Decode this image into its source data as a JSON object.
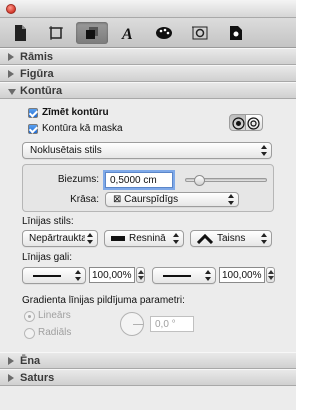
{
  "tabs": [
    {
      "icon": "document-icon",
      "active": false
    },
    {
      "icon": "ruler-icon",
      "active": false
    },
    {
      "icon": "graphic-icon",
      "active": true
    },
    {
      "icon": "text-icon",
      "active": false
    },
    {
      "icon": "color-palette-icon",
      "active": false
    },
    {
      "icon": "metrics-icon",
      "active": false
    },
    {
      "icon": "image-icon",
      "active": false
    }
  ],
  "sections": {
    "ramis": "Rāmis",
    "figura": "Figūra",
    "kontura": "Kontūra",
    "ena": "Ēna",
    "saturs": "Saturs"
  },
  "outline": {
    "draw_outline_label": "Zīmēt kontūru",
    "draw_outline_checked": true,
    "outline_as_mask_label": "Kontūra kā maska",
    "outline_as_mask_checked": true,
    "style_popup": "Noklusētais stils",
    "thickness_label": "Biezums:",
    "thickness_value": "0,5000 cm",
    "thickness_slider_fraction": 0.12,
    "color_label": "Krāsa:",
    "color_value": "⊠ Caurspīdīgs"
  },
  "line_style": {
    "label": "Līnijas stils:",
    "dash_popup": "Nepārtraukta",
    "cap_popup": "Resninā",
    "join_popup": "Taisns"
  },
  "line_ends": {
    "label": "Līnijas gali:",
    "start_scale": "100,00%",
    "end_scale": "100,00%"
  },
  "gradient": {
    "label": "Gradienta līnijas pildījuma parametri:",
    "linear_label": "Lineārs",
    "radial_label": "Radiāls",
    "angle_value": "0,0 °"
  },
  "colors": {
    "accent": "#1f6ad1",
    "focus": "#7fa9e8"
  }
}
